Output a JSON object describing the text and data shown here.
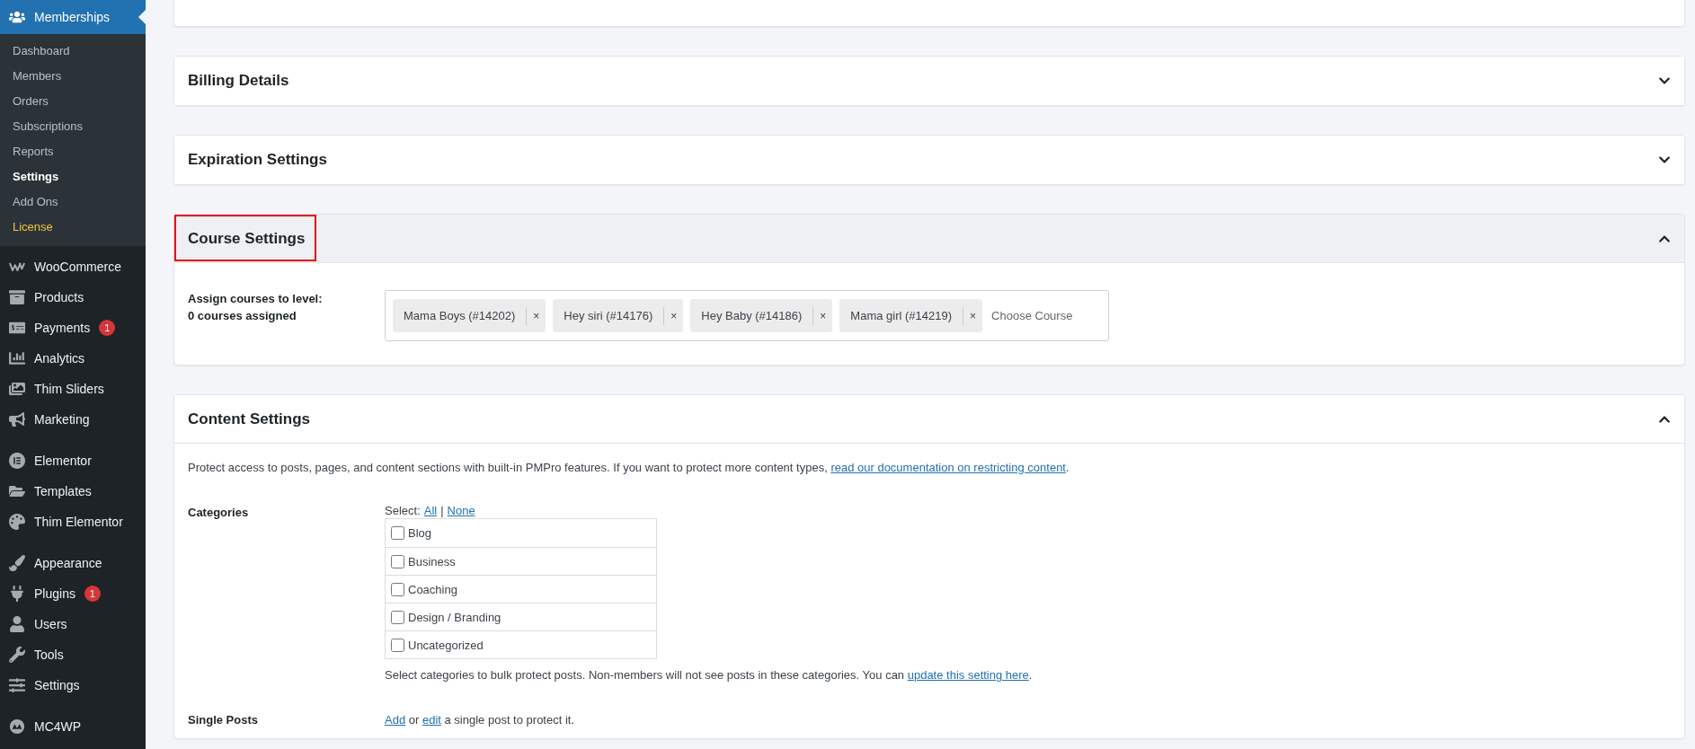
{
  "sidebar": {
    "current": {
      "label": "Memberships",
      "selected": true
    },
    "submenu": [
      {
        "label": "Dashboard",
        "selected": false,
        "kind": "link"
      },
      {
        "label": "Members",
        "selected": false,
        "kind": "link"
      },
      {
        "label": "Orders",
        "selected": false,
        "kind": "link"
      },
      {
        "label": "Subscriptions",
        "selected": false,
        "kind": "link"
      },
      {
        "label": "Reports",
        "selected": false,
        "kind": "link"
      },
      {
        "label": "Settings",
        "selected": true,
        "kind": "link"
      },
      {
        "label": "Add Ons",
        "selected": false,
        "kind": "link"
      },
      {
        "label": "License",
        "selected": false,
        "kind": "notice"
      }
    ],
    "groups": [
      [
        {
          "label": "WooCommerce"
        },
        {
          "label": "Products"
        },
        {
          "label": "Payments",
          "badge": "1"
        },
        {
          "label": "Analytics"
        },
        {
          "label": "Thim Sliders"
        },
        {
          "label": "Marketing"
        }
      ],
      [
        {
          "label": "Elementor"
        },
        {
          "label": "Templates"
        },
        {
          "label": "Thim Elementor"
        }
      ],
      [
        {
          "label": "Appearance"
        },
        {
          "label": "Plugins",
          "badge": "1"
        },
        {
          "label": "Users"
        },
        {
          "label": "Tools"
        },
        {
          "label": "Settings"
        }
      ],
      [
        {
          "label": "MC4WP"
        }
      ]
    ]
  },
  "sections": [
    {
      "title": "Billing Details",
      "expanded": false,
      "active": false
    },
    {
      "title": "Expiration Settings",
      "expanded": false,
      "active": false
    },
    {
      "kind": "courses",
      "title": "Course Settings",
      "expanded": true,
      "active": true,
      "annotated": true,
      "label": "Assign courses to level:",
      "sublabel": "0 courses assigned",
      "tags": [
        {
          "text": "Mama Boys (#14202)",
          "remove": "×"
        },
        {
          "text": "Hey siri (#14176)",
          "remove": "×"
        },
        {
          "text": "Hey Baby (#14186)",
          "remove": "×"
        },
        {
          "text": "Mama girl (#14219)",
          "remove": "×"
        }
      ],
      "placeholder": "Choose Course"
    },
    {
      "kind": "content",
      "title": "Content Settings",
      "expanded": true,
      "active": false,
      "annotated": false,
      "description": {
        "text": "Protect access to posts, pages, and content sections with built-in PMPro features. If you want to protect more content types, ",
        "link": "read our documentation on restricting content",
        "end": "."
      },
      "categories": {
        "label": "Categories",
        "select": "Select:",
        "all": "All",
        "separator": "|",
        "none": "None",
        "items": [
          {
            "label": "Blog",
            "checked": false
          },
          {
            "label": "Business",
            "checked": false
          },
          {
            "label": "Coaching",
            "checked": false
          },
          {
            "label": "Design / Branding",
            "checked": false
          },
          {
            "label": "Uncategorized",
            "checked": false
          }
        ],
        "help": {
          "text": "Select categories to bulk protect posts. Non-members will not see posts in these categories. You can ",
          "link": "update this setting here",
          "end": "."
        }
      },
      "single_posts": {
        "label": "Single Posts",
        "add": "Add",
        "or": " or ",
        "edit": "edit",
        "rest": " a single post to protect it."
      }
    }
  ]
}
